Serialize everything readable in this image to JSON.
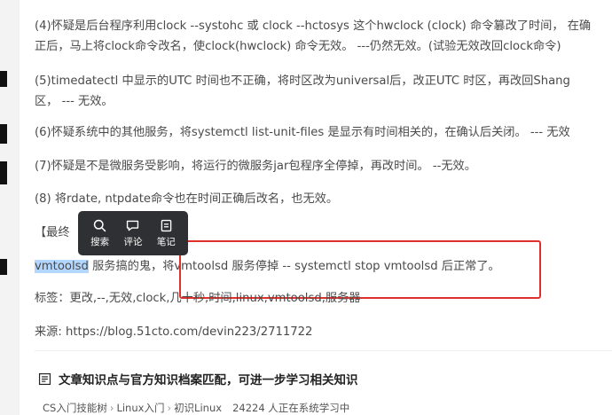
{
  "article": {
    "lines": [
      "(4)怀疑是后台程序利用clock --systohc 或 clock --hctosys 这个hwclock (clock) 命令篡改了时间， 在确",
      "正后，马上将clock命令改名，使clock(hwclock) 命令无效。  ---仍然无效。(试验无效改回clock命令)",
      "(5)timedatectl  中显示的UTC 时间也不正确，将时区改为universal后，改正UTC 时区，再改回Shang",
      "区， --- 无效。",
      "(6)怀疑系统中的其他服务，将systemctl list-unit-files 是显示有时间相关的，在确认后关闭。 --- 无效",
      "(7)怀疑是不是微服务受影响，将运行的微服务jar包程序全停掉，再改时间。   --无效。",
      "(8) 将rdate, ntpdate命令也在时间正确后改名，也无效。"
    ],
    "final_label": "【最终",
    "conclusion_highlight": "vmtoolsd",
    "conclusion_rest": " 服务搞的鬼，将vmtoolsd 服务停掉  --  systemctl stop vmtoolsd 后正常了。",
    "tags": "标签：更改,--,无效,clock,几十秒,时间,linux,vmtoolsd,服务器",
    "source": "来源:   https://blog.51cto.com/devin223/2711722"
  },
  "toolbar": {
    "items": [
      {
        "label": "搜索",
        "icon": "search-icon"
      },
      {
        "label": "评论",
        "icon": "comment-icon"
      },
      {
        "label": "笔记",
        "icon": "note-icon"
      }
    ]
  },
  "knowledge": {
    "title": "文章知识点与官方知识档案匹配，可进一步学习相关知识",
    "crumbs": [
      "CS入门技能树",
      "Linux入门",
      "初识Linux"
    ],
    "learners": "24224 人正在系统学习中"
  },
  "colors": {
    "highlight": "#b4d7ff",
    "annotation_box": "#e0302c",
    "toolbar_bg": "#2f3033"
  }
}
